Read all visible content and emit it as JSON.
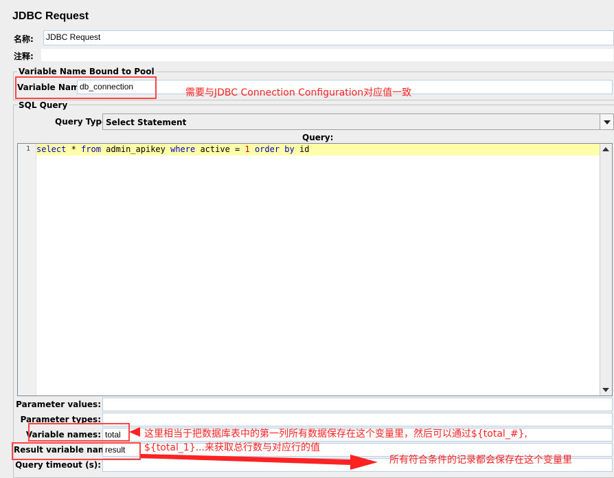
{
  "window": {
    "title": "JDBC Request"
  },
  "general": {
    "name_label": "名称:",
    "name_value": "JDBC Request",
    "comment_label": "注释:",
    "comment_value": ""
  },
  "pool_group": {
    "title": "Variable Name Bound to Pool",
    "variable_name_label": "Variable Name:",
    "variable_name_value": "db_connection"
  },
  "sql_group": {
    "title": "SQL Query",
    "query_type_label": "Query Type:",
    "query_type_value": "Select Statement",
    "query_label": "Query:",
    "line_number": "1",
    "code_tokens": {
      "t1": "select",
      "t2": " * ",
      "t3": "from",
      "t4": " admin_apikey ",
      "t5": "where",
      "t6": " active = ",
      "t7": "1",
      "t8": " ",
      "t9": "order by",
      "t10": " id"
    }
  },
  "params": {
    "param_values_label": "Parameter values:",
    "param_values_value": "",
    "param_types_label": "Parameter types:",
    "param_types_value": "",
    "variable_names_label": "Variable names:",
    "variable_names_value": "total",
    "result_variable_label": "Result variable name:",
    "result_variable_value": "result",
    "query_timeout_label": "Query timeout (s):",
    "query_timeout_value": ""
  },
  "annotations": {
    "note_pool": "需要与JDBC Connection Configuration对应值一致",
    "note_varnames_1": "这里相当于把数据库表中的第一列所有数据保存在这个变量里，然后可以通过${total_#},",
    "note_varnames_2": "${total_1}...来获取总行数与对应行的值",
    "note_result": "所有符合条件的记录都会保存在这个变量里",
    "color": "#ff2222"
  }
}
